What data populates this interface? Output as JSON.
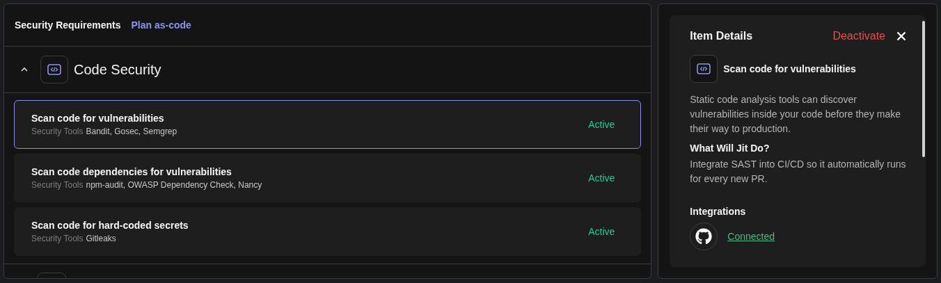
{
  "header": {
    "title": "Security Requirements",
    "link": "Plan as-code"
  },
  "section": {
    "title": "Code Security",
    "expanded": true,
    "items": [
      {
        "title": "Scan code for vulnerabilities",
        "tools_label": "Security Tools",
        "tools": "Bandit, Gosec, Semgrep",
        "status": "Active",
        "selected": true
      },
      {
        "title": "Scan code dependencies for vulnerabilities",
        "tools_label": "Security Tools",
        "tools": "npm-audit, OWASP Dependency Check, Nancy",
        "status": "Active",
        "selected": false
      },
      {
        "title": "Scan code for hard-coded secrets",
        "tools_label": "Security Tools",
        "tools": "Gitleaks",
        "status": "Active",
        "selected": false
      }
    ]
  },
  "details": {
    "title": "Item Details",
    "action": "Deactivate",
    "item_title": "Scan code for vulnerabilities",
    "description": "Static code analysis tools can discover vulnerabilities inside your code before they make their way to production.",
    "what_title": "What Will Jit Do?",
    "what_text": "Integrate SAST into CI/CD so it automatically runs for every new PR.",
    "integrations_title": "Integrations",
    "integration_status": "Connected"
  }
}
